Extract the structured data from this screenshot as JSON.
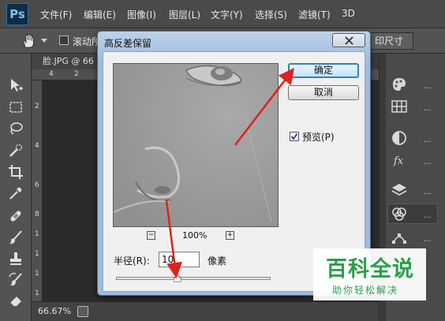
{
  "app": {
    "logo": "Ps",
    "menu": [
      "文件(F)",
      "编辑(E)",
      "图像(I)",
      "图层(L)",
      "文字(Y)",
      "选择(S)",
      "滤镜(T)",
      "3D"
    ]
  },
  "options_bar": {
    "checkbox_label": "滚动所",
    "button_label": "印尺寸"
  },
  "document": {
    "tab_title": "脸.JPG @ 66",
    "ruler_h_label": "4",
    "ruler_h_label_2": "2",
    "ruler_v_labels": [
      "2",
      "4",
      "6",
      "8",
      "1",
      "1",
      "1",
      "1"
    ],
    "zoom": "66.67%"
  },
  "dialog": {
    "title": "高反差保留",
    "ok_label": "确定",
    "cancel_label": "取消",
    "preview_label": "预览(P)",
    "preview_checked": true,
    "zoom_out": "−",
    "zoom_in": "+",
    "zoom_percent": "100%",
    "radius_label": "半径(R):",
    "radius_value": "10",
    "radius_unit": "像素"
  },
  "right_panel": {
    "dots": "..."
  },
  "watermark": {
    "title": "百科全说",
    "subtitle": "助你轻松解决"
  },
  "colors": {
    "annotation_arrow": "#e0201c",
    "default_button_border": "#3c7fb1",
    "watermark_green": "#2aa048"
  }
}
